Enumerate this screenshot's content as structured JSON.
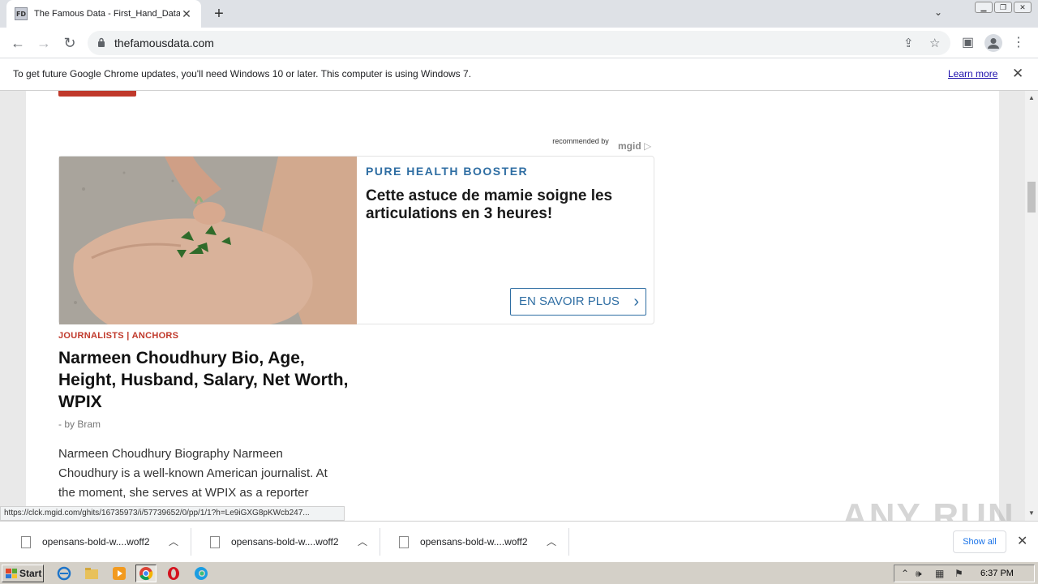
{
  "browser": {
    "tab": {
      "favicon_text": "FD",
      "title": "The Famous Data - First_Hand_Data"
    },
    "url": "thefamousdata.com",
    "window_buttons": [
      "minimize",
      "restore",
      "close"
    ]
  },
  "infobar": {
    "message": "To get future Google Chrome updates, you'll need Windows 10 or later. This computer is using Windows 7.",
    "link": "Learn more"
  },
  "ad": {
    "recommended_by": "recommended by",
    "network": "mgid",
    "brand": "PURE HEALTH BOOSTER",
    "headline": "Cette astuce de mamie soigne les articulations en 3 heures!",
    "cta": "EN SAVOIR PLUS"
  },
  "article": {
    "category": "JOURNALISTS | ANCHORS",
    "title": "Narmeen Choudhury Bio, Age, Height, Husband, Salary, Net Worth, WPIX",
    "byline": "- by Bram",
    "excerpt": "Narmeen Choudhury Biography Narmeen Choudhury is a well-known American journalist. At the moment, she serves at WPIX as a reporter"
  },
  "status_url": "https://clck.mgid.com/ghits/16735973/i/57739652/0/pp/1/1?h=Le9iGXG8pKWcb247...",
  "watermark": "ANY RUN",
  "downloads": {
    "items": [
      {
        "name": "opensans-bold-w....woff2"
      },
      {
        "name": "opensans-bold-w....woff2"
      },
      {
        "name": "opensans-bold-w....woff2"
      }
    ],
    "show_all": "Show all"
  },
  "taskbar": {
    "start": "Start",
    "clock": "6:37 PM"
  }
}
